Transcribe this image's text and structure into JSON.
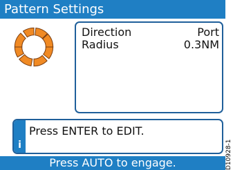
{
  "header": {
    "title": "Pattern Settings"
  },
  "pattern_icon": {
    "icon": "circle-pattern-icon",
    "color": "#f08a24"
  },
  "settings": [
    {
      "label": "Direction",
      "value": "Port"
    },
    {
      "label": "Radius",
      "value": "0.3NM"
    }
  ],
  "info": {
    "icon": "info-icon",
    "glyph": "i",
    "message": "Press ENTER to EDIT."
  },
  "footer": {
    "prompt": "Press AUTO to engage."
  },
  "figure_id": "D10928-1",
  "colors": {
    "accent": "#1f7fc4",
    "border": "#1f5f9a",
    "pattern": "#f08a24"
  }
}
